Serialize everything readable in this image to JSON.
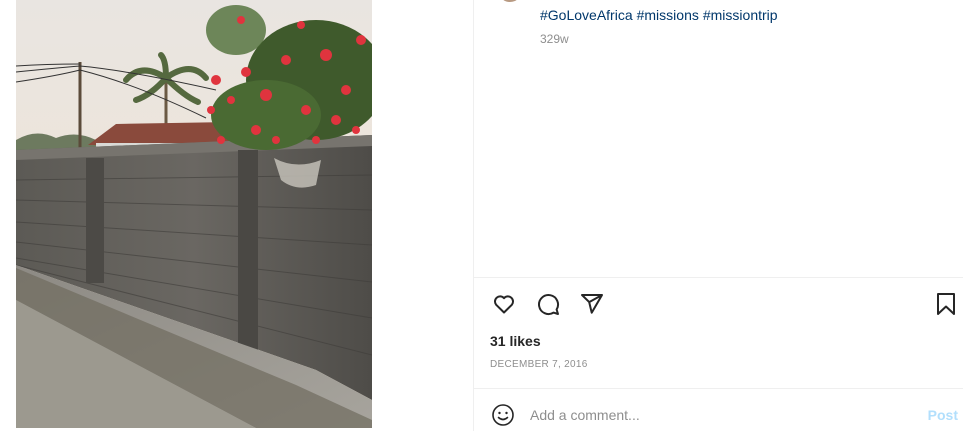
{
  "post": {
    "hashtags": [
      "#GoLoveAfrica",
      "#missions",
      "#missiontrip"
    ],
    "age": "329w",
    "likes": "31 likes",
    "date": "DECEMBER 7, 2016"
  },
  "actions": {
    "like_icon": "heart-icon",
    "comment_icon": "comment-bubble-icon",
    "share_icon": "paper-plane-icon",
    "save_icon": "bookmark-icon"
  },
  "comment": {
    "placeholder": "Add a comment...",
    "post_label": "Post",
    "emoji_icon": "smiley-icon"
  },
  "colors": {
    "hashtag": "#00376b",
    "post_disabled": "#b2dffc",
    "muted": "#8e8e8e"
  }
}
